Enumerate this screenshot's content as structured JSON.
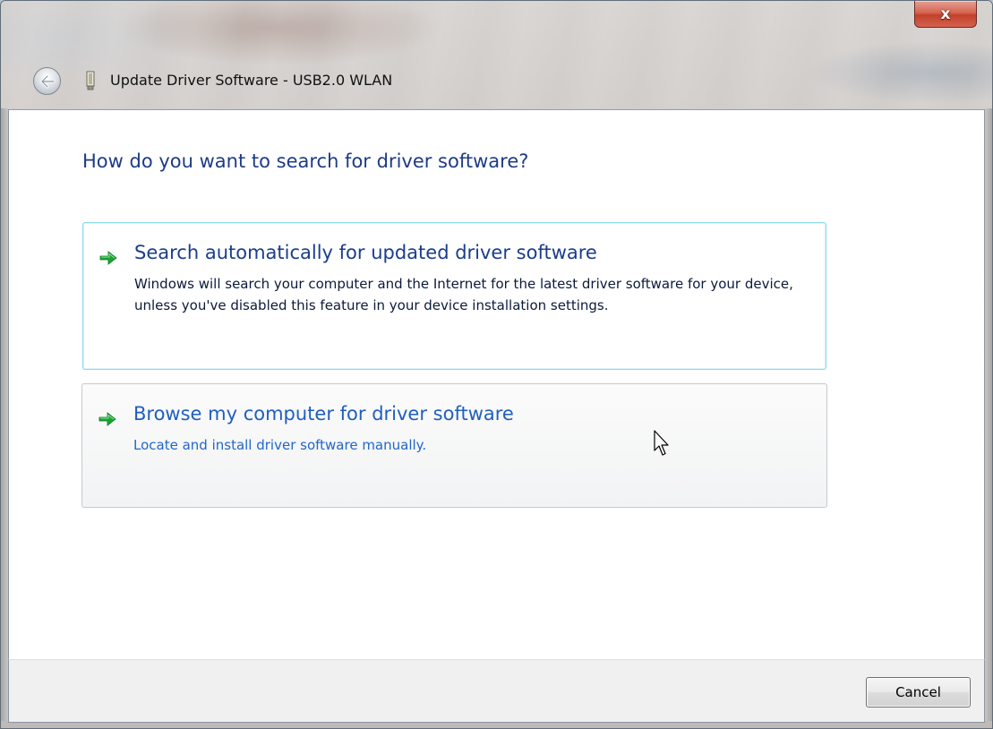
{
  "window": {
    "title": "Update Driver Software - USB2.0 WLAN",
    "close_glyph": "x"
  },
  "main": {
    "heading": "How do you want to search for driver software?",
    "options": [
      {
        "title": "Search automatically for updated driver software",
        "description": "Windows will search your computer and the Internet for the latest driver software for your device, unless you've disabled this feature in your device installation settings.",
        "icon": "green-arrow-icon"
      },
      {
        "title": "Browse my computer for driver software",
        "description": "Locate and install driver software manually.",
        "icon": "green-arrow-icon"
      }
    ]
  },
  "footer": {
    "cancel_label": "Cancel"
  },
  "colors": {
    "heading": "#1e3b86",
    "option_title": "#1a3d8d",
    "hover_link": "#1f5fbf",
    "arrow_green": "#1aa531",
    "close_red": "#c2412b"
  }
}
